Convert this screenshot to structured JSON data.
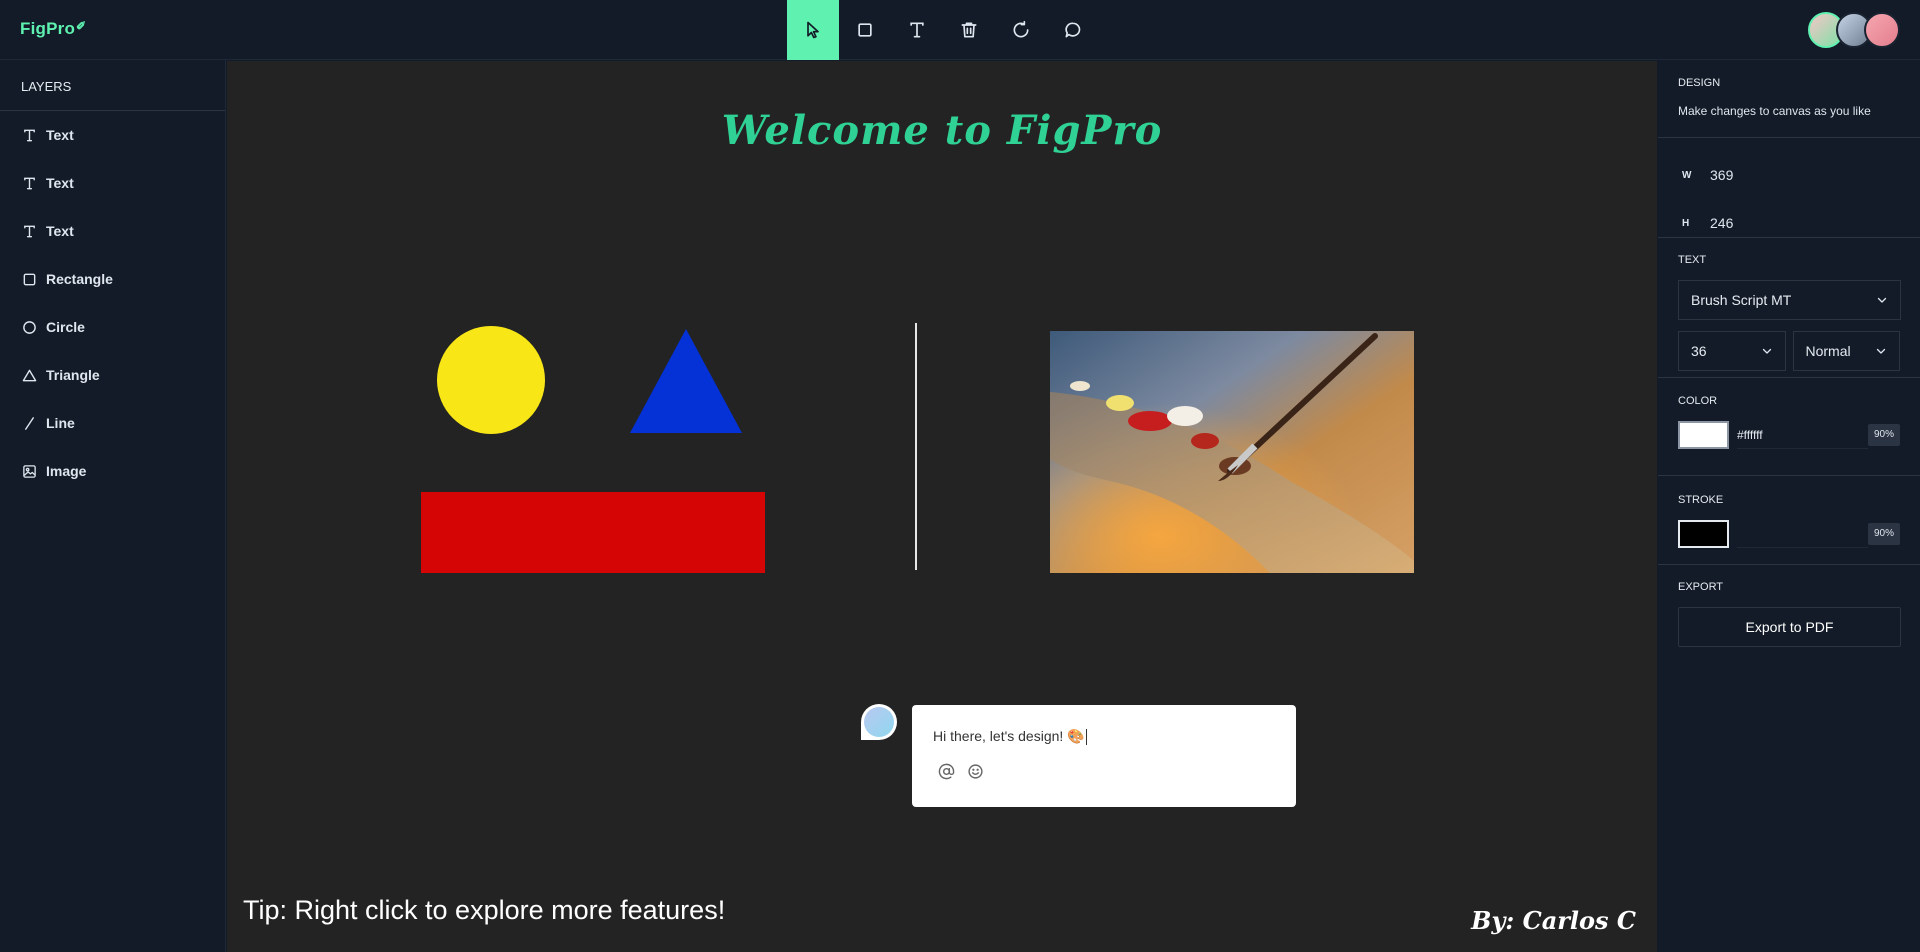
{
  "app": {
    "logo": "FigPro"
  },
  "toolbar": {
    "tools": [
      {
        "name": "select",
        "active": true
      },
      {
        "name": "rectangle",
        "active": false
      },
      {
        "name": "text",
        "active": false
      },
      {
        "name": "delete",
        "active": false
      },
      {
        "name": "reset",
        "active": false
      },
      {
        "name": "comments",
        "active": false
      }
    ]
  },
  "layers": {
    "title": "LAYERS",
    "items": [
      {
        "label": "Text",
        "icon": "text-icon"
      },
      {
        "label": "Text",
        "icon": "text-icon"
      },
      {
        "label": "Text",
        "icon": "text-icon"
      },
      {
        "label": "Rectangle",
        "icon": "rectangle-icon"
      },
      {
        "label": "Circle",
        "icon": "circle-icon"
      },
      {
        "label": "Triangle",
        "icon": "triangle-icon"
      },
      {
        "label": "Line",
        "icon": "line-icon"
      },
      {
        "label": "Image",
        "icon": "image-icon"
      }
    ]
  },
  "canvas": {
    "heading": "Welcome to FigPro",
    "tip": "Tip: Right click to explore more features!",
    "byline": "By: Carlos C",
    "colors": {
      "circle": "#f8e617",
      "triangle": "#0432d6",
      "rectangle": "#d50505",
      "heading": "#2fd294"
    }
  },
  "comment": {
    "text": "Hi there, let's design! 🎨"
  },
  "design": {
    "title": "DESIGN",
    "subtitle": "Make changes to canvas as you like",
    "width_label": "W",
    "width": "369",
    "height_label": "H",
    "height": "246"
  },
  "text_settings": {
    "title": "TEXT",
    "font_family": "Brush Script MT",
    "font_size": "36",
    "font_weight": "Normal"
  },
  "color": {
    "title": "COLOR",
    "value": "#ffffff",
    "opacity": "90%"
  },
  "stroke": {
    "title": "STROKE",
    "value": "#000000",
    "opacity": "90%"
  },
  "export": {
    "title": "EXPORT",
    "button": "Export to PDF"
  }
}
